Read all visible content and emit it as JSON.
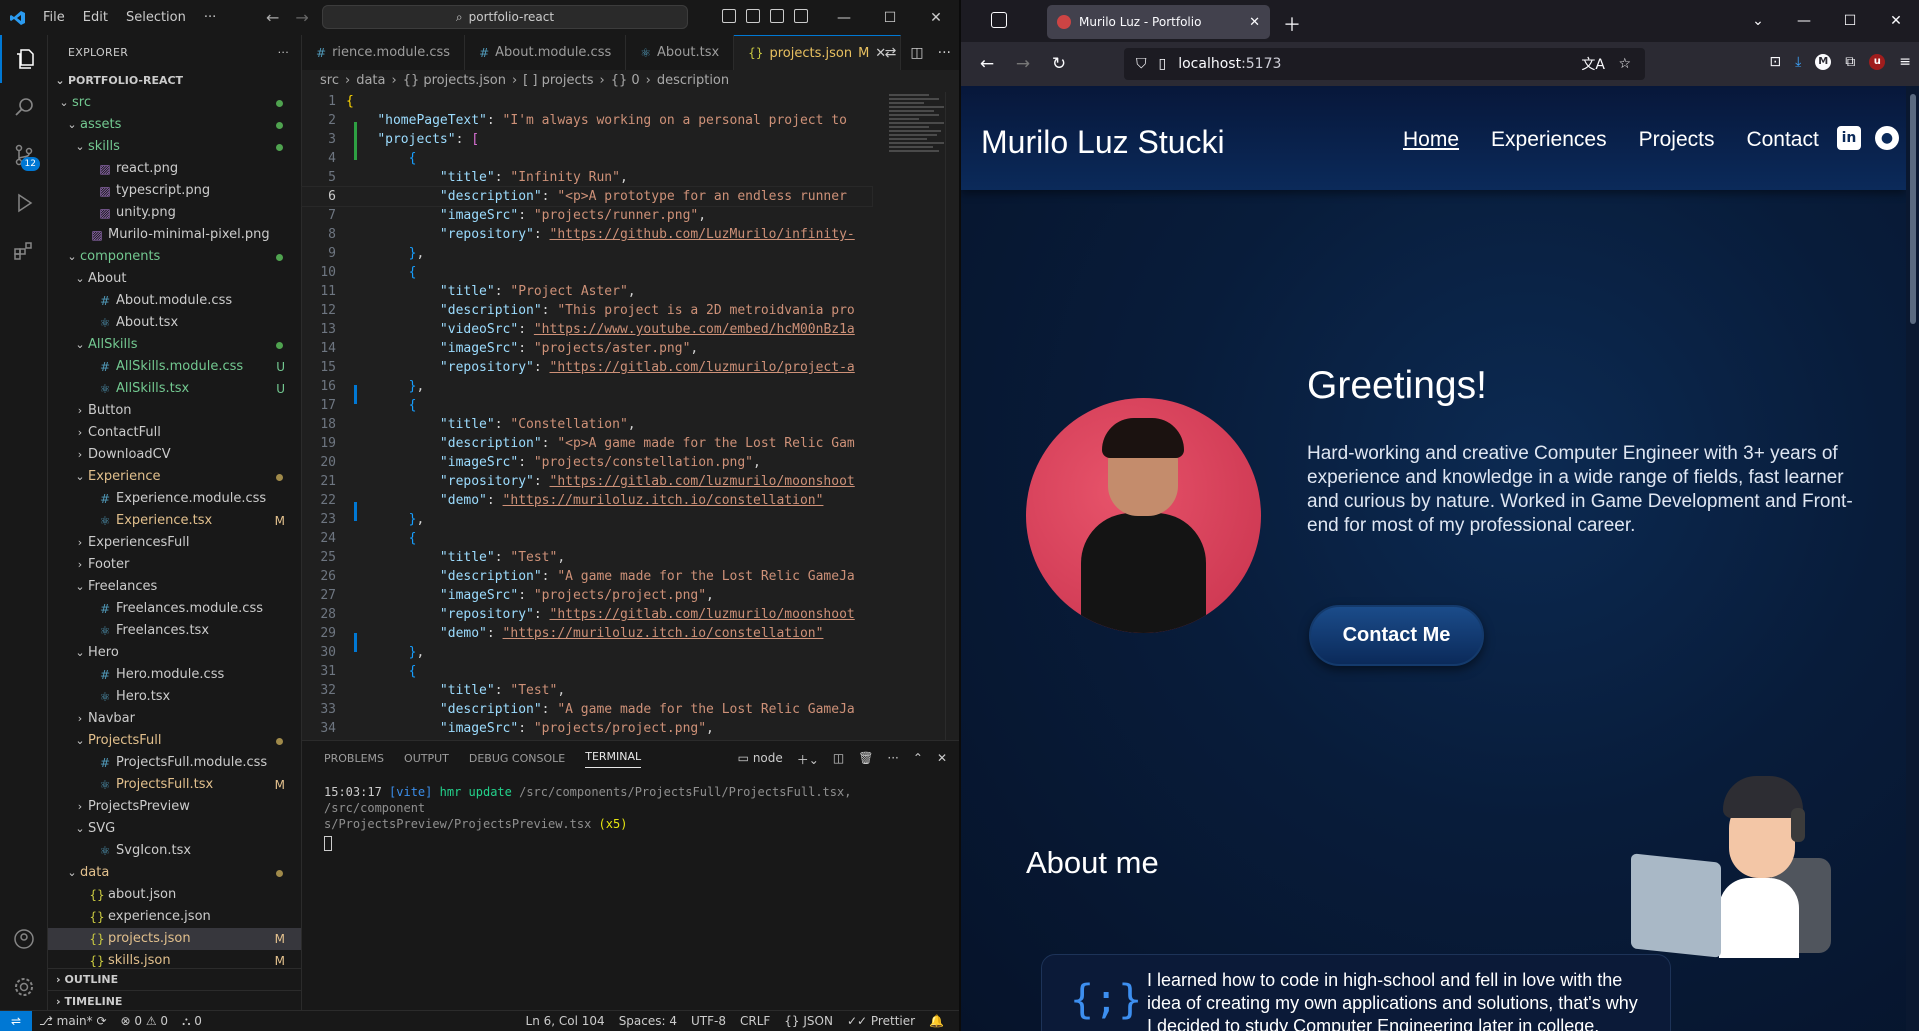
{
  "vscode": {
    "menu": [
      "File",
      "Edit",
      "Selection",
      "···"
    ],
    "search": "portfolio-react",
    "explorer_title": "EXPLORER",
    "project": "PORTFOLIO-REACT",
    "tree": [
      {
        "label": "src",
        "indent": 0,
        "kind": "folder-open",
        "dot": "#4fa34f",
        "color": "#73c991"
      },
      {
        "label": "assets",
        "indent": 1,
        "kind": "folder-open",
        "dot": "#4fa34f",
        "color": "#73c991"
      },
      {
        "label": "skills",
        "indent": 2,
        "kind": "folder-open",
        "dot": "#4fa34f",
        "color": "#73c991"
      },
      {
        "label": "react.png",
        "indent": 3,
        "kind": "img"
      },
      {
        "label": "typescript.png",
        "indent": 3,
        "kind": "img"
      },
      {
        "label": "unity.png",
        "indent": 3,
        "kind": "img"
      },
      {
        "label": "Murilo-minimal-pixel.png",
        "indent": 2,
        "kind": "img"
      },
      {
        "label": "components",
        "indent": 1,
        "kind": "folder-open",
        "dot": "#4fa34f",
        "color": "#73c991"
      },
      {
        "label": "About",
        "indent": 2,
        "kind": "folder-open"
      },
      {
        "label": "About.module.css",
        "indent": 3,
        "kind": "css"
      },
      {
        "label": "About.tsx",
        "indent": 3,
        "kind": "tsx"
      },
      {
        "label": "AllSkills",
        "indent": 2,
        "kind": "folder-open",
        "dot": "#4fa34f",
        "color": "#73c991"
      },
      {
        "label": "AllSkills.module.css",
        "indent": 3,
        "kind": "css",
        "status": "U",
        "color": "#73c991"
      },
      {
        "label": "AllSkills.tsx",
        "indent": 3,
        "kind": "tsx",
        "status": "U",
        "color": "#73c991"
      },
      {
        "label": "Button",
        "indent": 2,
        "kind": "folder"
      },
      {
        "label": "ContactFull",
        "indent": 2,
        "kind": "folder"
      },
      {
        "label": "DownloadCV",
        "indent": 2,
        "kind": "folder"
      },
      {
        "label": "Experience",
        "indent": 2,
        "kind": "folder-open",
        "dot": "#a08a4a",
        "color": "#e2c08d"
      },
      {
        "label": "Experience.module.css",
        "indent": 3,
        "kind": "css"
      },
      {
        "label": "Experience.tsx",
        "indent": 3,
        "kind": "tsx",
        "status": "M",
        "color": "#e2c08d"
      },
      {
        "label": "ExperiencesFull",
        "indent": 2,
        "kind": "folder"
      },
      {
        "label": "Footer",
        "indent": 2,
        "kind": "folder"
      },
      {
        "label": "Freelances",
        "indent": 2,
        "kind": "folder-open"
      },
      {
        "label": "Freelances.module.css",
        "indent": 3,
        "kind": "css"
      },
      {
        "label": "Freelances.tsx",
        "indent": 3,
        "kind": "tsx"
      },
      {
        "label": "Hero",
        "indent": 2,
        "kind": "folder-open"
      },
      {
        "label": "Hero.module.css",
        "indent": 3,
        "kind": "css"
      },
      {
        "label": "Hero.tsx",
        "indent": 3,
        "kind": "tsx"
      },
      {
        "label": "Navbar",
        "indent": 2,
        "kind": "folder"
      },
      {
        "label": "ProjectsFull",
        "indent": 2,
        "kind": "folder-open",
        "dot": "#a08a4a",
        "color": "#e2c08d"
      },
      {
        "label": "ProjectsFull.module.css",
        "indent": 3,
        "kind": "css"
      },
      {
        "label": "ProjectsFull.tsx",
        "indent": 3,
        "kind": "tsx",
        "status": "M",
        "color": "#e2c08d"
      },
      {
        "label": "ProjectsPreview",
        "indent": 2,
        "kind": "folder"
      },
      {
        "label": "SVG",
        "indent": 2,
        "kind": "folder-open"
      },
      {
        "label": "SvgIcon.tsx",
        "indent": 3,
        "kind": "tsx"
      },
      {
        "label": "data",
        "indent": 1,
        "kind": "folder-open",
        "dot": "#a08a4a",
        "color": "#e2c08d"
      },
      {
        "label": "about.json",
        "indent": 2,
        "kind": "json"
      },
      {
        "label": "experience.json",
        "indent": 2,
        "kind": "json"
      },
      {
        "label": "projects.json",
        "indent": 2,
        "kind": "json",
        "status": "M",
        "color": "#e2c08d",
        "selected": true
      },
      {
        "label": "skills.json",
        "indent": 2,
        "kind": "json",
        "status": "M",
        "color": "#e2c08d"
      }
    ],
    "outline": "OUTLINE",
    "timeline": "TIMELINE",
    "tabs": [
      {
        "label": "rience.module.css",
        "icon": "#",
        "iconColor": "#519aba"
      },
      {
        "label": "About.module.css",
        "icon": "#",
        "iconColor": "#519aba"
      },
      {
        "label": "About.tsx",
        "icon": "⚛",
        "iconColor": "#519aba"
      },
      {
        "label": "projects.json",
        "icon": "{}",
        "iconColor": "#cbcb41",
        "active": true,
        "status": "M"
      }
    ],
    "breadcrumbs": [
      "src",
      "data",
      "{} projects.json",
      "[ ] projects",
      "{} 0",
      "description"
    ],
    "code": [
      [
        [
          "b1",
          "{"
        ]
      ],
      [
        [
          "p",
          "    "
        ],
        [
          "k",
          "\"homePageText\""
        ],
        [
          "p",
          ": "
        ],
        [
          "s",
          "\"I'm always working on a personal project to"
        ]
      ],
      [
        [
          "p",
          "    "
        ],
        [
          "k",
          "\"projects\""
        ],
        [
          "p",
          ": "
        ],
        [
          "b2",
          "["
        ]
      ],
      [
        [
          "p",
          "        "
        ],
        [
          "b3",
          "{"
        ]
      ],
      [
        [
          "p",
          "            "
        ],
        [
          "k",
          "\"title\""
        ],
        [
          "p",
          ": "
        ],
        [
          "s",
          "\"Infinity Run\""
        ],
        [
          "p",
          ","
        ]
      ],
      [
        [
          "p",
          "            "
        ],
        [
          "k",
          "\"description\""
        ],
        [
          "p",
          ": "
        ],
        [
          "s",
          "\"<p>A prototype for an endless runner"
        ]
      ],
      [
        [
          "p",
          "            "
        ],
        [
          "k",
          "\"imageSrc\""
        ],
        [
          "p",
          ": "
        ],
        [
          "s",
          "\"projects/runner.png\""
        ],
        [
          "p",
          ","
        ]
      ],
      [
        [
          "p",
          "            "
        ],
        [
          "k",
          "\"repository\""
        ],
        [
          "p",
          ": "
        ],
        [
          "u",
          "\"https://github.com/LuzMurilo/infinity-"
        ]
      ],
      [
        [
          "p",
          "        "
        ],
        [
          "b3",
          "}"
        ],
        [
          "p",
          ","
        ]
      ],
      [
        [
          "p",
          "        "
        ],
        [
          "b3",
          "{"
        ]
      ],
      [
        [
          "p",
          "            "
        ],
        [
          "k",
          "\"title\""
        ],
        [
          "p",
          ": "
        ],
        [
          "s",
          "\"Project Aster\""
        ],
        [
          "p",
          ","
        ]
      ],
      [
        [
          "p",
          "            "
        ],
        [
          "k",
          "\"description\""
        ],
        [
          "p",
          ": "
        ],
        [
          "s",
          "\"This project is a 2D metroidvania pro"
        ]
      ],
      [
        [
          "p",
          "            "
        ],
        [
          "k",
          "\"videoSrc\""
        ],
        [
          "p",
          ": "
        ],
        [
          "u",
          "\"https://www.youtube.com/embed/hcM00nBz1a"
        ]
      ],
      [
        [
          "p",
          "            "
        ],
        [
          "k",
          "\"imageSrc\""
        ],
        [
          "p",
          ": "
        ],
        [
          "s",
          "\"projects/aster.png\""
        ],
        [
          "p",
          ","
        ]
      ],
      [
        [
          "p",
          "            "
        ],
        [
          "k",
          "\"repository\""
        ],
        [
          "p",
          ": "
        ],
        [
          "u",
          "\"https://gitlab.com/luzmurilo/project-a"
        ]
      ],
      [
        [
          "p",
          "        "
        ],
        [
          "b3",
          "}"
        ],
        [
          "p",
          ","
        ]
      ],
      [
        [
          "p",
          "        "
        ],
        [
          "b3",
          "{"
        ]
      ],
      [
        [
          "p",
          "            "
        ],
        [
          "k",
          "\"title\""
        ],
        [
          "p",
          ": "
        ],
        [
          "s",
          "\"Constellation\""
        ],
        [
          "p",
          ","
        ]
      ],
      [
        [
          "p",
          "            "
        ],
        [
          "k",
          "\"description\""
        ],
        [
          "p",
          ": "
        ],
        [
          "s",
          "\"<p>A game made for the Lost Relic Gam"
        ]
      ],
      [
        [
          "p",
          "            "
        ],
        [
          "k",
          "\"imageSrc\""
        ],
        [
          "p",
          ": "
        ],
        [
          "s",
          "\"projects/constellation.png\""
        ],
        [
          "p",
          ","
        ]
      ],
      [
        [
          "p",
          "            "
        ],
        [
          "k",
          "\"repository\""
        ],
        [
          "p",
          ": "
        ],
        [
          "u",
          "\"https://gitlab.com/luzmurilo/moonshoot"
        ]
      ],
      [
        [
          "p",
          "            "
        ],
        [
          "k",
          "\"demo\""
        ],
        [
          "p",
          ": "
        ],
        [
          "u",
          "\"https://muriloluz.itch.io/constellation\""
        ]
      ],
      [
        [
          "p",
          "        "
        ],
        [
          "b3",
          "}"
        ],
        [
          "p",
          ","
        ]
      ],
      [
        [
          "p",
          "        "
        ],
        [
          "b3",
          "{"
        ]
      ],
      [
        [
          "p",
          "            "
        ],
        [
          "k",
          "\"title\""
        ],
        [
          "p",
          ": "
        ],
        [
          "s",
          "\"Test\""
        ],
        [
          "p",
          ","
        ]
      ],
      [
        [
          "p",
          "            "
        ],
        [
          "k",
          "\"description\""
        ],
        [
          "p",
          ": "
        ],
        [
          "s",
          "\"A game made for the Lost Relic GameJa"
        ]
      ],
      [
        [
          "p",
          "            "
        ],
        [
          "k",
          "\"imageSrc\""
        ],
        [
          "p",
          ": "
        ],
        [
          "s",
          "\"projects/project.png\""
        ],
        [
          "p",
          ","
        ]
      ],
      [
        [
          "p",
          "            "
        ],
        [
          "k",
          "\"repository\""
        ],
        [
          "p",
          ": "
        ],
        [
          "u",
          "\"https://gitlab.com/luzmurilo/moonshoot"
        ]
      ],
      [
        [
          "p",
          "            "
        ],
        [
          "k",
          "\"demo\""
        ],
        [
          "p",
          ": "
        ],
        [
          "u",
          "\"https://muriloluz.itch.io/constellation\""
        ]
      ],
      [
        [
          "p",
          "        "
        ],
        [
          "b3",
          "}"
        ],
        [
          "p",
          ","
        ]
      ],
      [
        [
          "p",
          "        "
        ],
        [
          "b3",
          "{"
        ]
      ],
      [
        [
          "p",
          "            "
        ],
        [
          "k",
          "\"title\""
        ],
        [
          "p",
          ": "
        ],
        [
          "s",
          "\"Test\""
        ],
        [
          "p",
          ","
        ]
      ],
      [
        [
          "p",
          "            "
        ],
        [
          "k",
          "\"description\""
        ],
        [
          "p",
          ": "
        ],
        [
          "s",
          "\"A game made for the Lost Relic GameJa"
        ]
      ],
      [
        [
          "p",
          "            "
        ],
        [
          "k",
          "\"imageSrc\""
        ],
        [
          "p",
          ": "
        ],
        [
          "s",
          "\"projects/project.png\""
        ],
        [
          "p",
          ","
        ]
      ]
    ],
    "current_line": 6,
    "panel_tabs": [
      "PROBLEMS",
      "OUTPUT",
      "DEBUG CONSOLE",
      "TERMINAL"
    ],
    "terminal_shell": "node",
    "terminal": {
      "time": "15:03:17",
      "tag": "[vite]",
      "msg": "hmr update",
      "paths": "/src/components/ProjectsFull/ProjectsFull.tsx, /src/component",
      "paths2": "s/ProjectsPreview/ProjectsPreview.tsx",
      "count": "(x5)"
    },
    "status": {
      "branch": "main*",
      "errors": "0",
      "warnings": "0",
      "ports": "0",
      "position": "Ln 6, Col 104",
      "spaces": "Spaces: 4",
      "encoding": "UTF-8",
      "eol": "CRLF",
      "language": "JSON",
      "formatter": "Prettier"
    }
  },
  "browser": {
    "tab_title": "Murilo Luz - Portfolio",
    "url_host": "localhost",
    "url_port": ":5173",
    "site": {
      "brand": "Murilo Luz Stucki",
      "nav": [
        "Home",
        "Experiences",
        "Projects",
        "Contact"
      ],
      "greeting": "Greetings!",
      "bio": "Hard-working and creative Computer Engineer with 3+ years of experience and knowledge in a wide range of fields, fast learner and curious by nature. Worked in Game Development and Front-end for most of my professional career.",
      "cta": "Contact Me",
      "about_title": "About me",
      "about_card": "I learned how to code in high-school and fell in love with the idea of creating my own applications and solutions, that's why I decided to study Computer Engineering later in college."
    }
  }
}
